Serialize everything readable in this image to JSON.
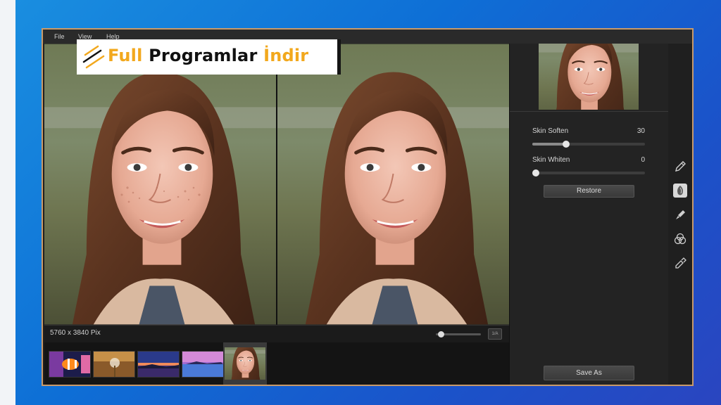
{
  "menu": {
    "file": "File",
    "view": "View",
    "help": "Help"
  },
  "watermark": {
    "word1": "Full",
    "word2": " Programlar ",
    "word3": "İndir"
  },
  "status": {
    "dimensions": "5760 x 3840 Pix",
    "zoom_level": 0.05,
    "zoom_button": "1/A"
  },
  "adjustments": {
    "skin_soften": {
      "label": "Skin Soften",
      "value": "30",
      "fraction": 0.3
    },
    "skin_whiten": {
      "label": "Skin Whiten",
      "value": "0",
      "fraction": 0.0
    }
  },
  "buttons": {
    "restore": "Restore",
    "save_as": "Save As"
  },
  "filmstrip": {
    "thumbnails": [
      "clownfish",
      "dandelion",
      "sunset-lake",
      "pink-lake",
      "portrait"
    ],
    "selected_index": 4
  },
  "tools": [
    "pencil-icon",
    "skin-icon",
    "brush-icon",
    "color-circles-icon",
    "eyedropper-icon"
  ],
  "colors": {
    "frame": "#c89a6a",
    "panel": "#232323",
    "background": "#1b6fd8",
    "watermark_accent": "#f2a81d"
  }
}
